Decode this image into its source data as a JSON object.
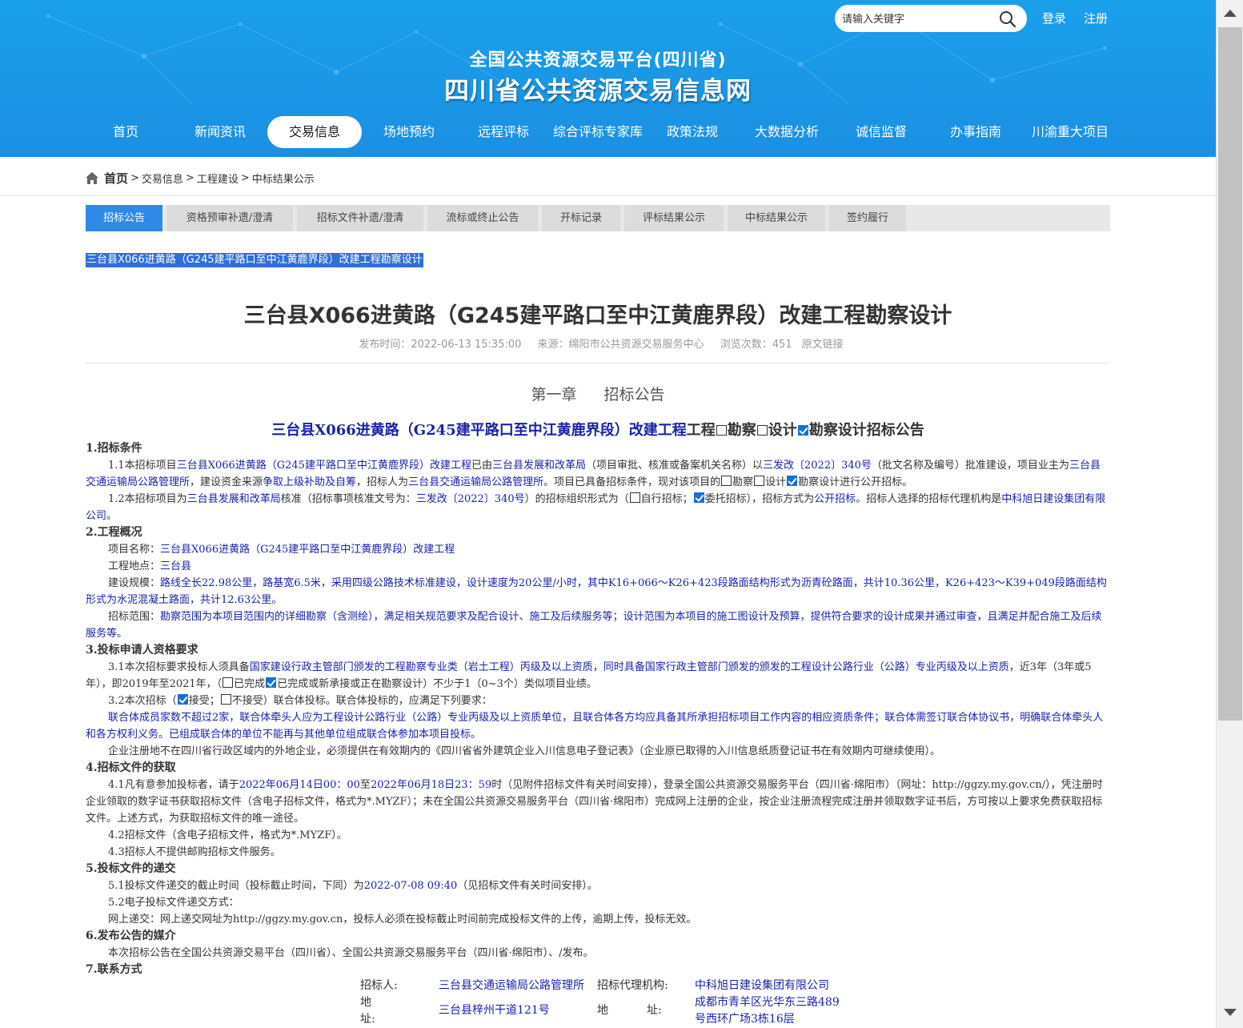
{
  "header": {
    "search_placeholder": "请输入关键字",
    "login": "登录",
    "register": "注册",
    "subtitle": "全国公共资源交易平台(四川省)",
    "title": "四川省公共资源交易信息网",
    "nav": [
      "首页",
      "新闻资讯",
      "交易信息",
      "场地预约",
      "远程评标",
      "综合评标专家库",
      "政策法规",
      "大数据分析",
      "诚信监督",
      "办事指南",
      "川渝重大项目"
    ],
    "active_nav": "交易信息"
  },
  "breadcrumb": {
    "home": "首页",
    "items": [
      "交易信息",
      "工程建设",
      "中标结果公示"
    ],
    "sep": ">"
  },
  "tabs": [
    "招标公告",
    "资格预审补遗/澄清",
    "招标文件补遗/澄清",
    "流标或终止公告",
    "开标记录",
    "评标结果公示",
    "中标结果公示",
    "签约履行"
  ],
  "active_tab": "招标公告",
  "selected_title": "三台县X066进黄路（G245建平路口至中江黄鹿界段）改建工程勘察设计",
  "article": {
    "title": "三台县X066进黄路（G245建平路口至中江黄鹿界段）改建工程勘察设计",
    "publish_time": "发布时间：2022-06-13 15:35:00",
    "source": "来源：绵阳市公共资源交易服务中心",
    "views": "浏览次数：451",
    "original_link": "原文链接",
    "chapter_no": "第一章",
    "chapter_name": "招标公告",
    "notice_title_blue": "三台县X066进黄路（G245建平路口至中江黄鹿界段）改建工程",
    "notice_title_rest1": "工程",
    "notice_title_rest2": "勘察",
    "notice_title_rest3": "设计",
    "notice_title_rest4": "勘察设计招标公告"
  },
  "sections": {
    "s1": "1.招标条件",
    "s2": "2.工程概况",
    "s3": "3.投标申请人资格要求",
    "s4": "4.招标文件的获取",
    "s5": "5.投标文件的递交",
    "s6": "6.发布公告的媒介",
    "s7": "7.联系方式"
  },
  "contact": {
    "tenderer_label": "招标人:",
    "tenderer": "三台县交通运输局公路管理所",
    "agent_label": "招标代理机构:",
    "agent": "中科旭日建设集团有限公司",
    "addr_label1": "地",
    "addr_label2": "址:",
    "tenderer_addr": "三台县梓州干道121号",
    "agent_addr_label1": "地",
    "agent_addr_label2": "址:",
    "agent_addr_line1": "成都市青羊区光华东三路489",
    "agent_addr_line2": "号西环广场3栋16层"
  }
}
